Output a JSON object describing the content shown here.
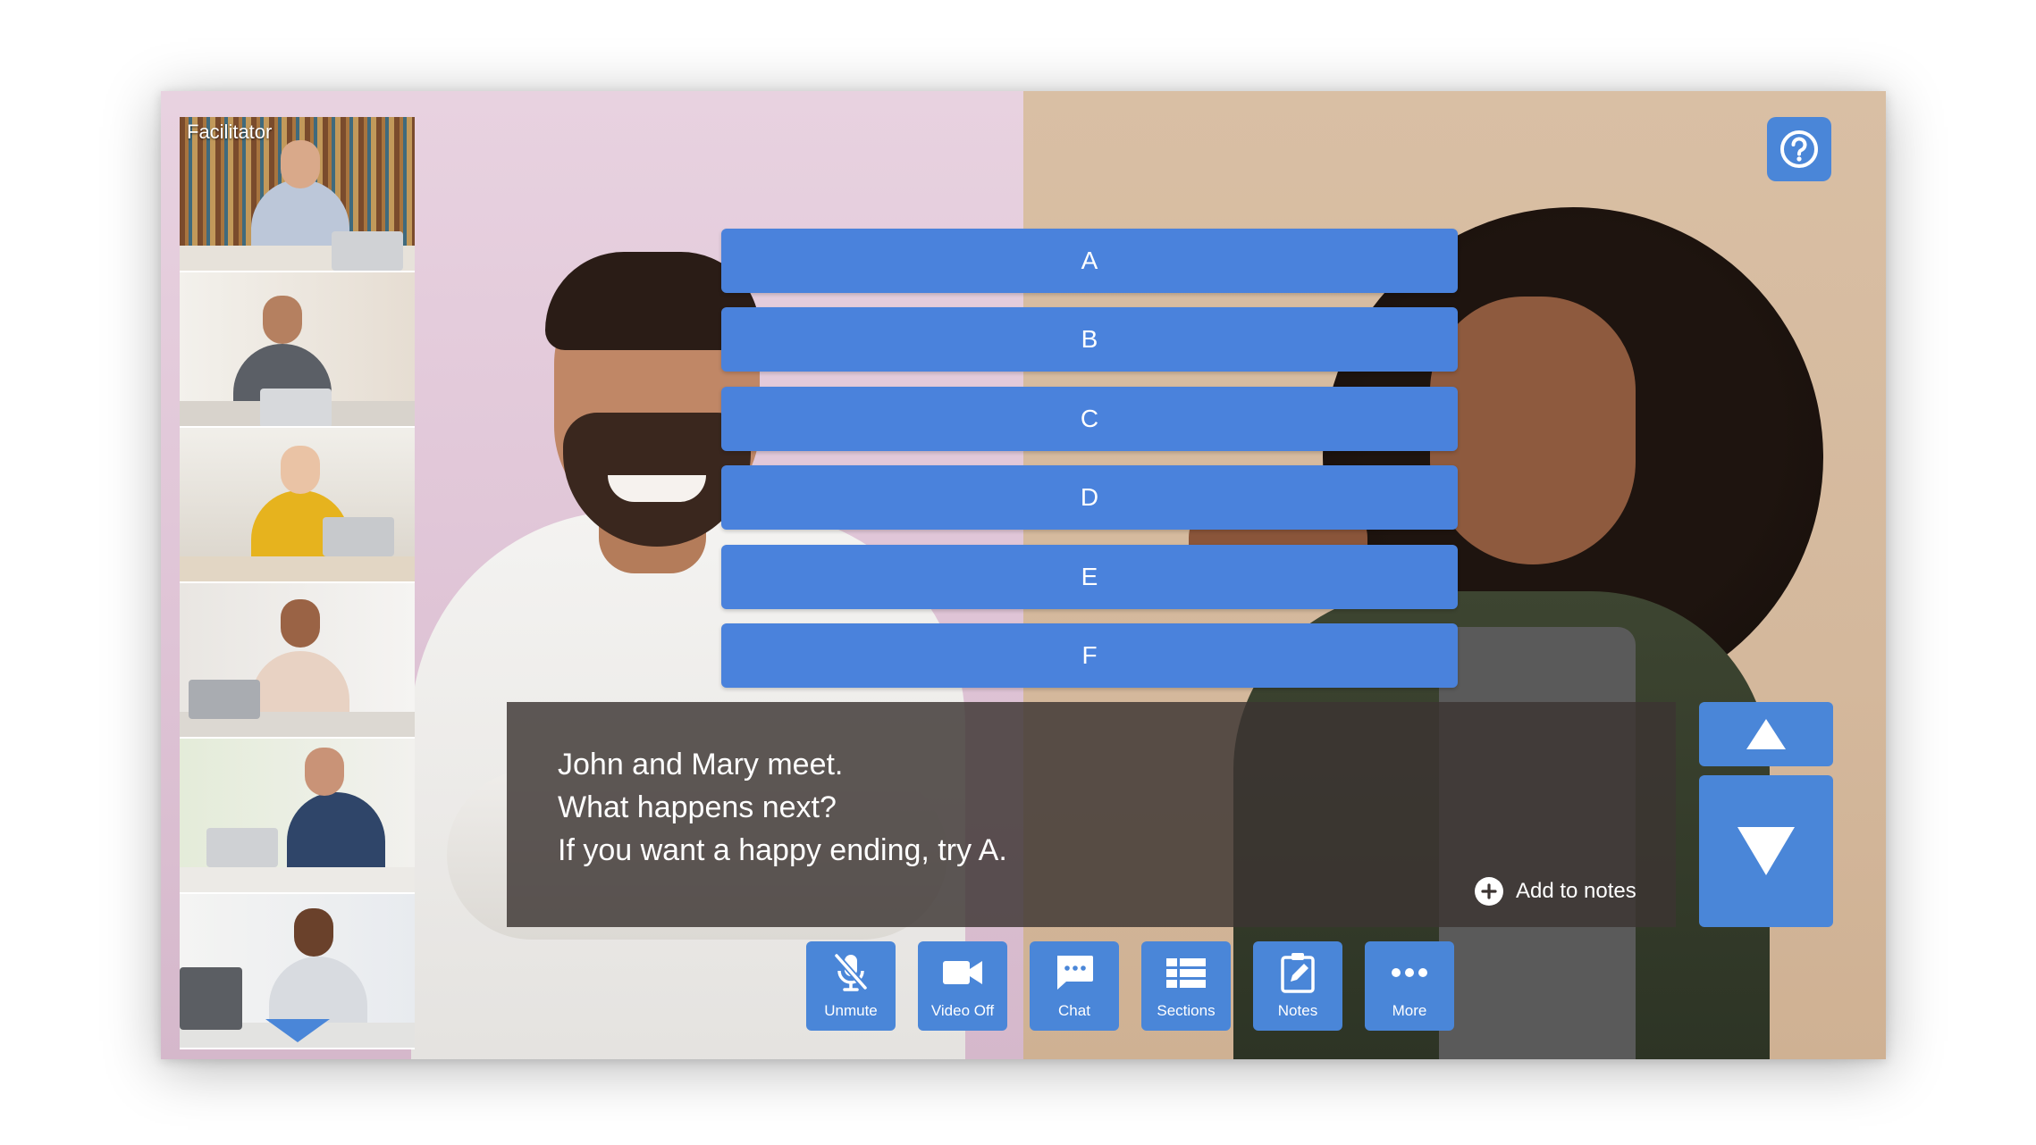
{
  "facilitator_label": "Facilitator",
  "options": [
    {
      "label": "A"
    },
    {
      "label": "B"
    },
    {
      "label": "C"
    },
    {
      "label": "D"
    },
    {
      "label": "E"
    },
    {
      "label": "F"
    }
  ],
  "caption": {
    "lines": [
      "John and Mary meet.",
      "What happens next?",
      "If you want a happy ending, try A."
    ],
    "add_to_notes": "Add to notes"
  },
  "toolbar": [
    {
      "label": "Unmute",
      "icon": "mic-off-icon"
    },
    {
      "label": "Video Off",
      "icon": "video-camera-icon"
    },
    {
      "label": "Chat",
      "icon": "chat-icon"
    },
    {
      "label": "Sections",
      "icon": "sections-icon"
    },
    {
      "label": "Notes",
      "icon": "notes-icon"
    },
    {
      "label": "More",
      "icon": "more-icon"
    }
  ],
  "colors": {
    "accent": "#4a86d8",
    "caption_bg": "#3c3432"
  }
}
